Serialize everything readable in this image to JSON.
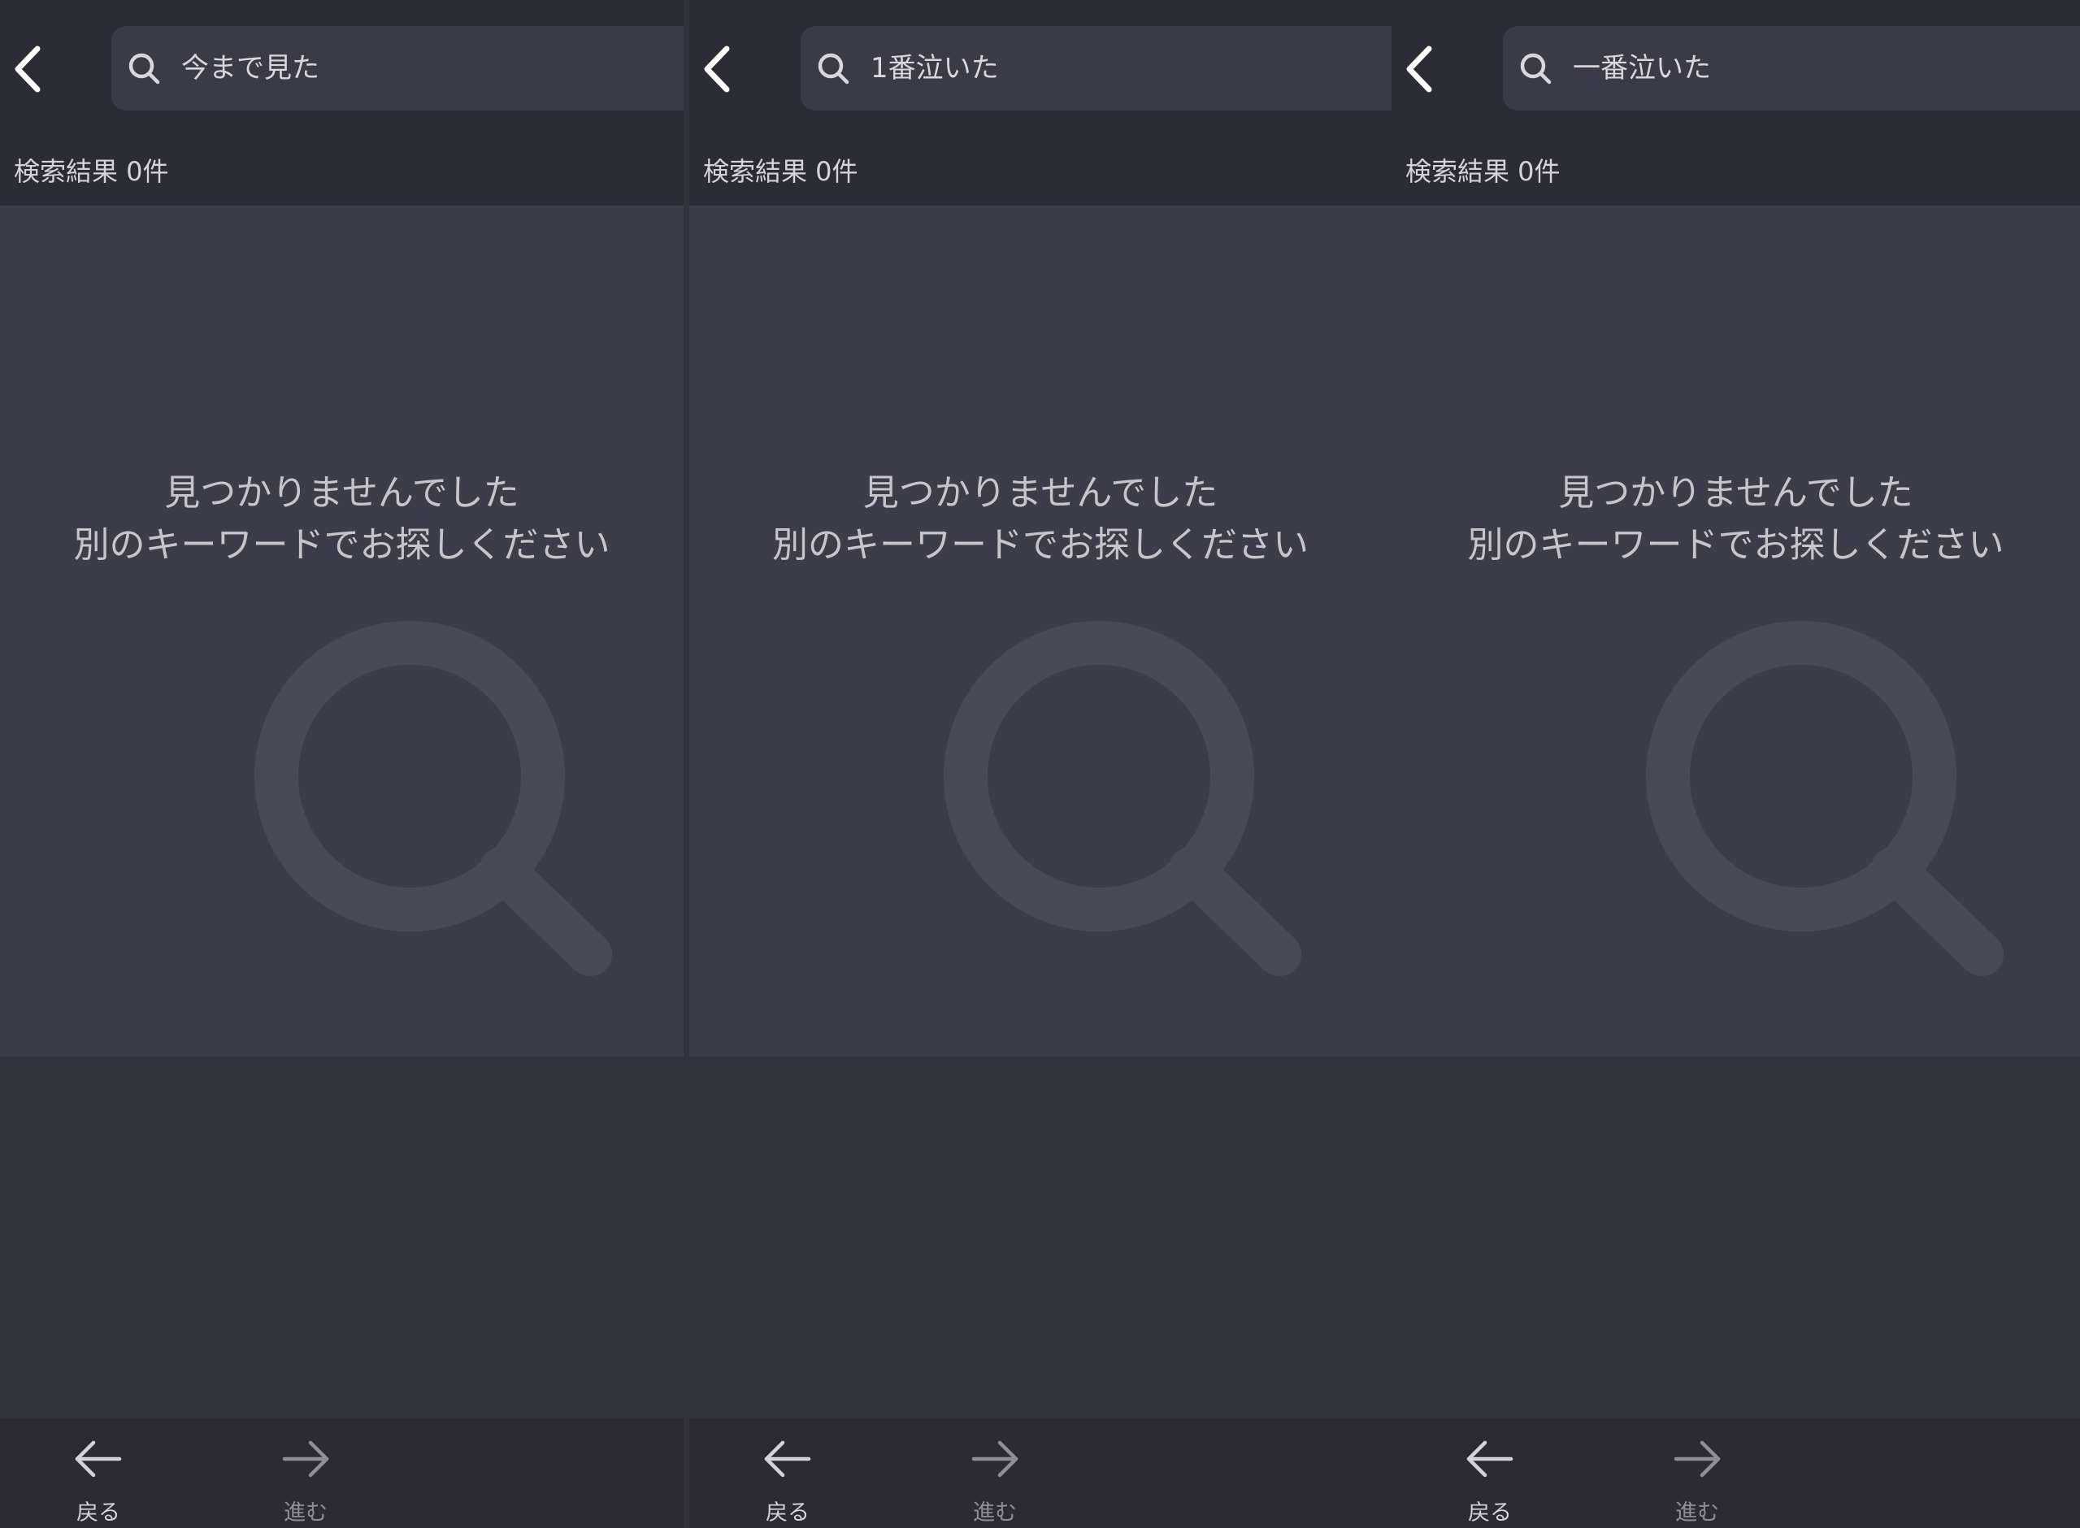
{
  "panels": [
    {
      "search": {
        "value": "今まで見た"
      },
      "result_count": "検索結果 0件",
      "empty": {
        "title": "見つかりませんでした",
        "subtitle": "別のキーワードでお探しください"
      },
      "footer": {
        "back_label": "戻る",
        "forward_label": "進む"
      }
    },
    {
      "search": {
        "value": "1番泣いた"
      },
      "result_count": "検索結果 0件",
      "empty": {
        "title": "見つかりませんでした",
        "subtitle": "別のキーワードでお探しください"
      },
      "footer": {
        "back_label": "戻る",
        "forward_label": "進む"
      }
    },
    {
      "search": {
        "value": "一番泣いた"
      },
      "result_count": "検索結果 0件",
      "empty": {
        "title": "見つかりませんでした",
        "subtitle": "別のキーワードでお探しください"
      },
      "footer": {
        "back_label": "戻る",
        "forward_label": "進む"
      }
    }
  ],
  "icons": {
    "back": "chevron-left-icon",
    "search": "search-icon",
    "empty_state": "search-icon",
    "nav_back": "arrow-left-icon",
    "nav_forward": "arrow-right-icon"
  },
  "colors": {
    "header_bg": "#2c2b38",
    "search_field_bg": "#3b3a48",
    "content_bg": "#3d3c4a",
    "page_bg": "#32313e",
    "footer_bg": "#2b2a36",
    "primary_text": "#d8d7de",
    "muted_text": "#8f8e98"
  }
}
